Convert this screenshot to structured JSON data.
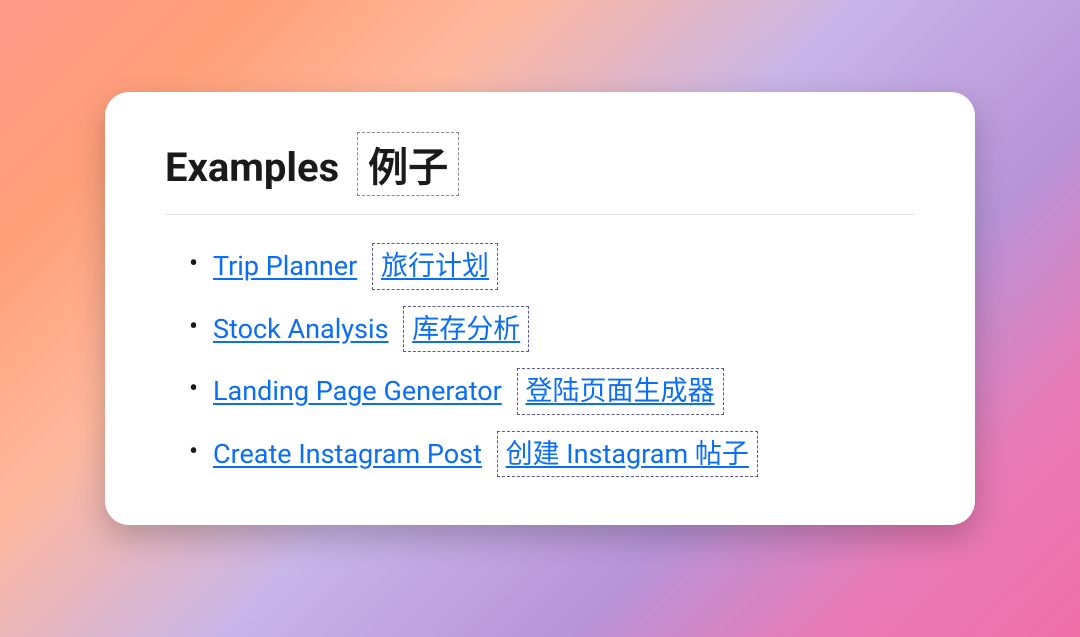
{
  "heading": {
    "text": "Examples",
    "translation": "例子"
  },
  "examples": [
    {
      "label": "Trip Planner",
      "translation": "旅行计划"
    },
    {
      "label": "Stock Analysis",
      "translation": "库存分析"
    },
    {
      "label": "Landing Page Generator",
      "translation": "登陆页面生成器"
    },
    {
      "label": "Create Instagram Post",
      "translation": "创建 Instagram 帖子"
    }
  ]
}
